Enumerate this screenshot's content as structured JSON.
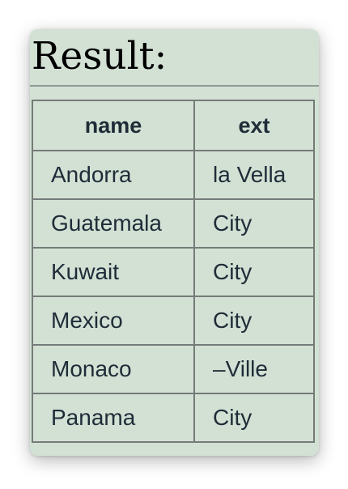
{
  "result": {
    "title": "Result:",
    "columns": [
      "name",
      "ext"
    ],
    "rows": [
      {
        "name": "Andorra",
        "ext": "la Vella"
      },
      {
        "name": "Guatemala",
        "ext": "City"
      },
      {
        "name": "Kuwait",
        "ext": "City"
      },
      {
        "name": "Mexico",
        "ext": "City"
      },
      {
        "name": "Monaco",
        "ext": "–Ville"
      },
      {
        "name": "Panama",
        "ext": "City"
      }
    ]
  }
}
